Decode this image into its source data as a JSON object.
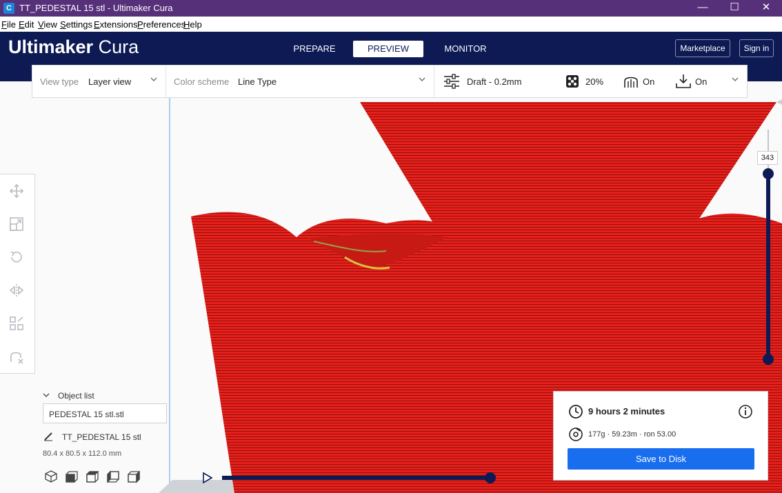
{
  "window": {
    "title": "TT_PEDESTAL 15 stl - Ultimaker Cura",
    "app_icon_letter": "C",
    "minimize": "—",
    "maximize": "☐",
    "close": "✕"
  },
  "menu": [
    "File",
    "Edit",
    "View",
    "Settings",
    "Extensions",
    "Preferences",
    "Help"
  ],
  "header": {
    "logo_bold": "Ultimaker",
    "logo_light": "Cura",
    "tabs": [
      "PREPARE",
      "PREVIEW",
      "MONITOR"
    ],
    "active_tab": "PREVIEW",
    "marketplace_label": "Marketplace",
    "signin_label": "Sign in"
  },
  "toolbar": {
    "view_type_label": "View type",
    "view_type_value": "Layer view",
    "color_scheme_label": "Color scheme",
    "color_scheme_value": "Line Type",
    "profile": "Draft - 0.2mm",
    "infill": "20%",
    "support": "On",
    "adhesion": "On"
  },
  "left_tools": [
    "move-icon",
    "scale-icon",
    "rotate-icon",
    "mirror-icon",
    "per-model-settings-icon",
    "support-blocker-icon"
  ],
  "object_list": {
    "heading": "Object list",
    "file": "PEDESTAL 15 stl.stl",
    "object_name": "TT_PEDESTAL 15 stl",
    "dimensions": "80.4 x 80.5 x 112.0 mm"
  },
  "camera_views": [
    "3d-view-icon",
    "front-view-icon",
    "top-view-icon",
    "left-view-icon",
    "right-view-icon"
  ],
  "layer_slider": {
    "current_layer": "343",
    "max_layer": 343,
    "min_layer": 1
  },
  "path_slider": {
    "progress": 1.0
  },
  "print_info": {
    "time": "9 hours 2 minutes",
    "material": "177g · 59.23m · ron 53.00",
    "save_label": "Save to Disk"
  },
  "colors": {
    "title_bar": "#57307a",
    "header": "#0d1a54",
    "accent": "#196ef0",
    "model_red": "#e8201b",
    "slider": "#0d1a54"
  }
}
